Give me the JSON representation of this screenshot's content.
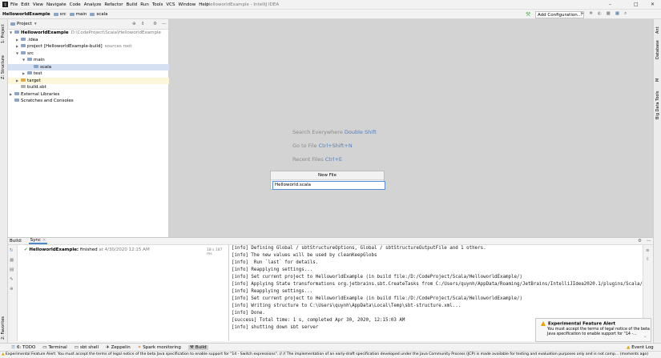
{
  "titlebar": {
    "menu": [
      "File",
      "Edit",
      "View",
      "Navigate",
      "Code",
      "Analyze",
      "Refactor",
      "Build",
      "Run",
      "Tools",
      "VCS",
      "Window",
      "Help"
    ],
    "title": "HelloworldExample - IntelliJ IDEA",
    "minimize": "–",
    "maximize": "□",
    "close": "✕"
  },
  "navbar": {
    "crumbs": [
      "HelloworldExample",
      "src",
      "main",
      "scala"
    ],
    "add_configuration": "Add Configuration..."
  },
  "left_strip": {
    "project": "1: Project",
    "structure": "Z: Structure",
    "favorites": "2: Favorites"
  },
  "right_strip": {
    "ant": "Ant",
    "database": "Database",
    "m": "M",
    "bigdata": "Big Data Tools"
  },
  "project_panel": {
    "label": "Project",
    "tree": [
      {
        "indent": 0,
        "arrow": "▼",
        "text": "HelloworldExample",
        "extra": "D:\\CodeProject\\Scala\\HelloworldExample",
        "bold": true
      },
      {
        "indent": 1,
        "arrow": "▶",
        "text": ".idea",
        "extra": ""
      },
      {
        "indent": 1,
        "arrow": "▶",
        "text": "project [HelloworldExample-build]",
        "extra": "sources root"
      },
      {
        "indent": 1,
        "arrow": "▼",
        "text": "src",
        "extra": ""
      },
      {
        "indent": 2,
        "arrow": "▼",
        "text": "main",
        "extra": ""
      },
      {
        "indent": 3,
        "arrow": "",
        "text": "scala",
        "extra": "",
        "selected": true
      },
      {
        "indent": 2,
        "arrow": "▶",
        "text": "test",
        "extra": ""
      },
      {
        "indent": 1,
        "arrow": "▶",
        "text": "target",
        "extra": "",
        "highlight": true
      },
      {
        "indent": 1,
        "arrow": "",
        "text": "build.sbt",
        "extra": ""
      },
      {
        "indent": 0,
        "arrow": "▶",
        "text": "External Libraries",
        "extra": ""
      },
      {
        "indent": 0,
        "arrow": "",
        "text": "Scratches and Consoles",
        "extra": ""
      }
    ]
  },
  "editor_hints": {
    "search_label": "Search Everywhere",
    "search_key": "Double Shift",
    "goto_label": "Go to File",
    "goto_key": "Ctrl+Shift+N",
    "recent_label": "Recent Files",
    "recent_key": "Ctrl+E"
  },
  "new_file": {
    "title": "New File",
    "value": "Helloworld.scala"
  },
  "build": {
    "label": "Build:",
    "tab": "Sync",
    "tree_name": "HelloworldExample:",
    "tree_status": "finished",
    "tree_time": "at 4/30/2020 12:15 AM",
    "duration": "18 s 187 ms",
    "console": [
      "[info] Defining Global / sbtStructureOptions, Global / sbtStructureOutputFile and 1 others.",
      "[info] The new values will be used by cleanKeepGlobs",
      "[info]  Run `last` for details.",
      "[info] Reapplying settings...",
      "[info] Set current project to HelloworldExample (in build file:/D:/CodeProject/Scala/HelloworldExample/)",
      "[info] Applying State transformations org.jetbrains.sbt.CreateTasks from C:/Users/quynh/AppData/Roaming/JetBrains/IntelliJIdea2020.1/plugins/Scala/re",
      "[info] Reapplying settings...",
      "[info] Set current project to HelloworldExample (in build file:/D:/CodeProject/Scala/HelloworldExample/)",
      "[info] Writing structure to C:\\Users\\quynh\\AppData\\Local\\Temp\\sbt-structure.xml...",
      "[info] Done.",
      "[success] Total time: 1 s, completed Apr 30, 2020, 12:15:03 AM",
      "[info] shutting down sbt server"
    ]
  },
  "toolwindows": [
    "6: TODO",
    "Terminal",
    "sbt shell",
    "Zeppelin",
    "Spark monitoring",
    "Build"
  ],
  "event_log": "Event Log",
  "notification": {
    "title": "Experimental Feature Alert",
    "body": "You must accept the terms of legal notice of the beta Java specification to enable support for \"14 -..."
  },
  "statusbar": {
    "text": "Experimental Feature Alert: You must accept the terms of legal notice of the beta Java specification to enable support for \"14 - Switch expressions\". // // The implementation of an early-draft specification developed under the Java Community Process (JCP) is made available for testing and evaluation purposes only and is not comp... (moments ago)"
  }
}
